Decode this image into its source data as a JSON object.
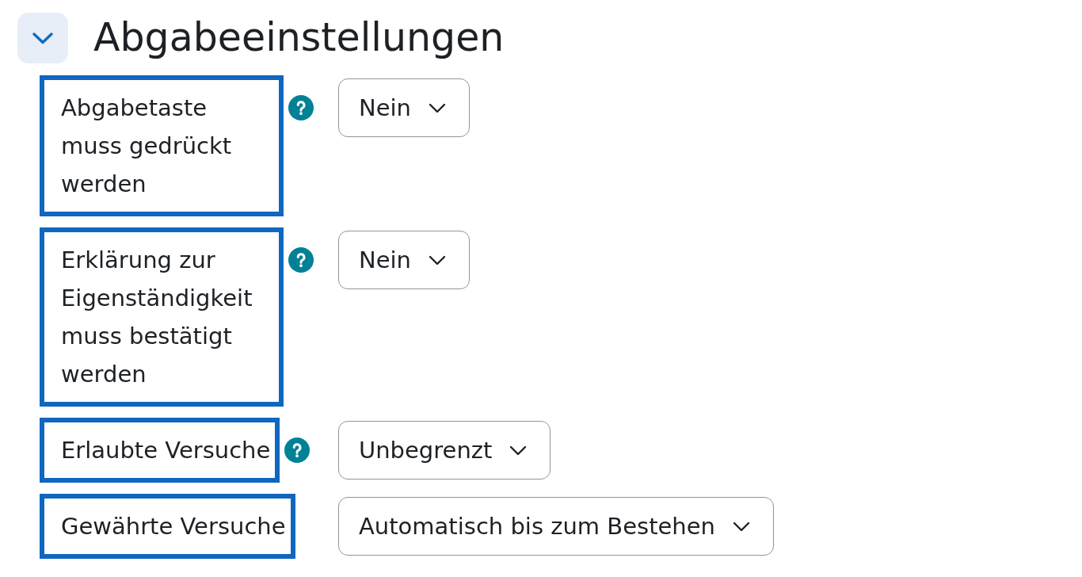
{
  "section": {
    "title": "Abgabeeinstellungen",
    "expanded": true
  },
  "fields": [
    {
      "label": "Abgabetaste muss gedrückt werden",
      "highlighted": true,
      "help": true,
      "value": "Nein"
    },
    {
      "label": "Erklärung zur Eigenständigkeit muss bestätigt werden",
      "highlighted": true,
      "help": true,
      "value": "Nein"
    },
    {
      "label": "Erlaubte Versuche",
      "highlighted": true,
      "help": true,
      "value": "Unbegrenzt"
    },
    {
      "label": "Gewährte Versuche",
      "highlighted": true,
      "help": false,
      "value": "Automatisch bis zum Bestehen"
    }
  ]
}
